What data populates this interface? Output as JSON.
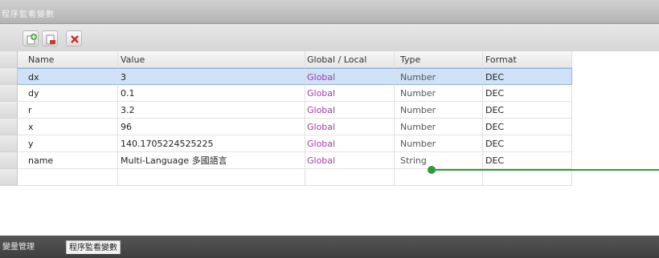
{
  "window": {
    "title": "程序監看變數"
  },
  "toolbar": {
    "buttons": [
      {
        "icon": "add-variable-icon"
      },
      {
        "icon": "edit-variable-icon"
      },
      {
        "icon": "delete-variable-icon"
      }
    ]
  },
  "grid": {
    "columns": [
      "Name",
      "Value",
      "Global / Local",
      "Type",
      "Format"
    ],
    "rows": [
      {
        "name": "dx",
        "value": "3",
        "scope": "Global",
        "type": "Number",
        "format": "DEC",
        "selected": true
      },
      {
        "name": "dy",
        "value": "0.1",
        "scope": "Global",
        "type": "Number",
        "format": "DEC"
      },
      {
        "name": "r",
        "value": "3.2",
        "scope": "Global",
        "type": "Number",
        "format": "DEC"
      },
      {
        "name": "x",
        "value": "96",
        "scope": "Global",
        "type": "Number",
        "format": "DEC"
      },
      {
        "name": "y",
        "value": "140.1705224525225",
        "scope": "Global",
        "type": "Number",
        "format": "DEC"
      },
      {
        "name": "name",
        "value": "Multi-Language 多國語言",
        "scope": "Global",
        "type": "String",
        "format": "DEC"
      }
    ]
  },
  "bottom_tabs": [
    {
      "label": "變量管理",
      "active": false
    },
    {
      "label": "程序監看變數",
      "active": true
    }
  ],
  "colors": {
    "callout": "#2e9a3a",
    "selection": "#cfe1f6",
    "scope_text": "#a03aa8"
  }
}
